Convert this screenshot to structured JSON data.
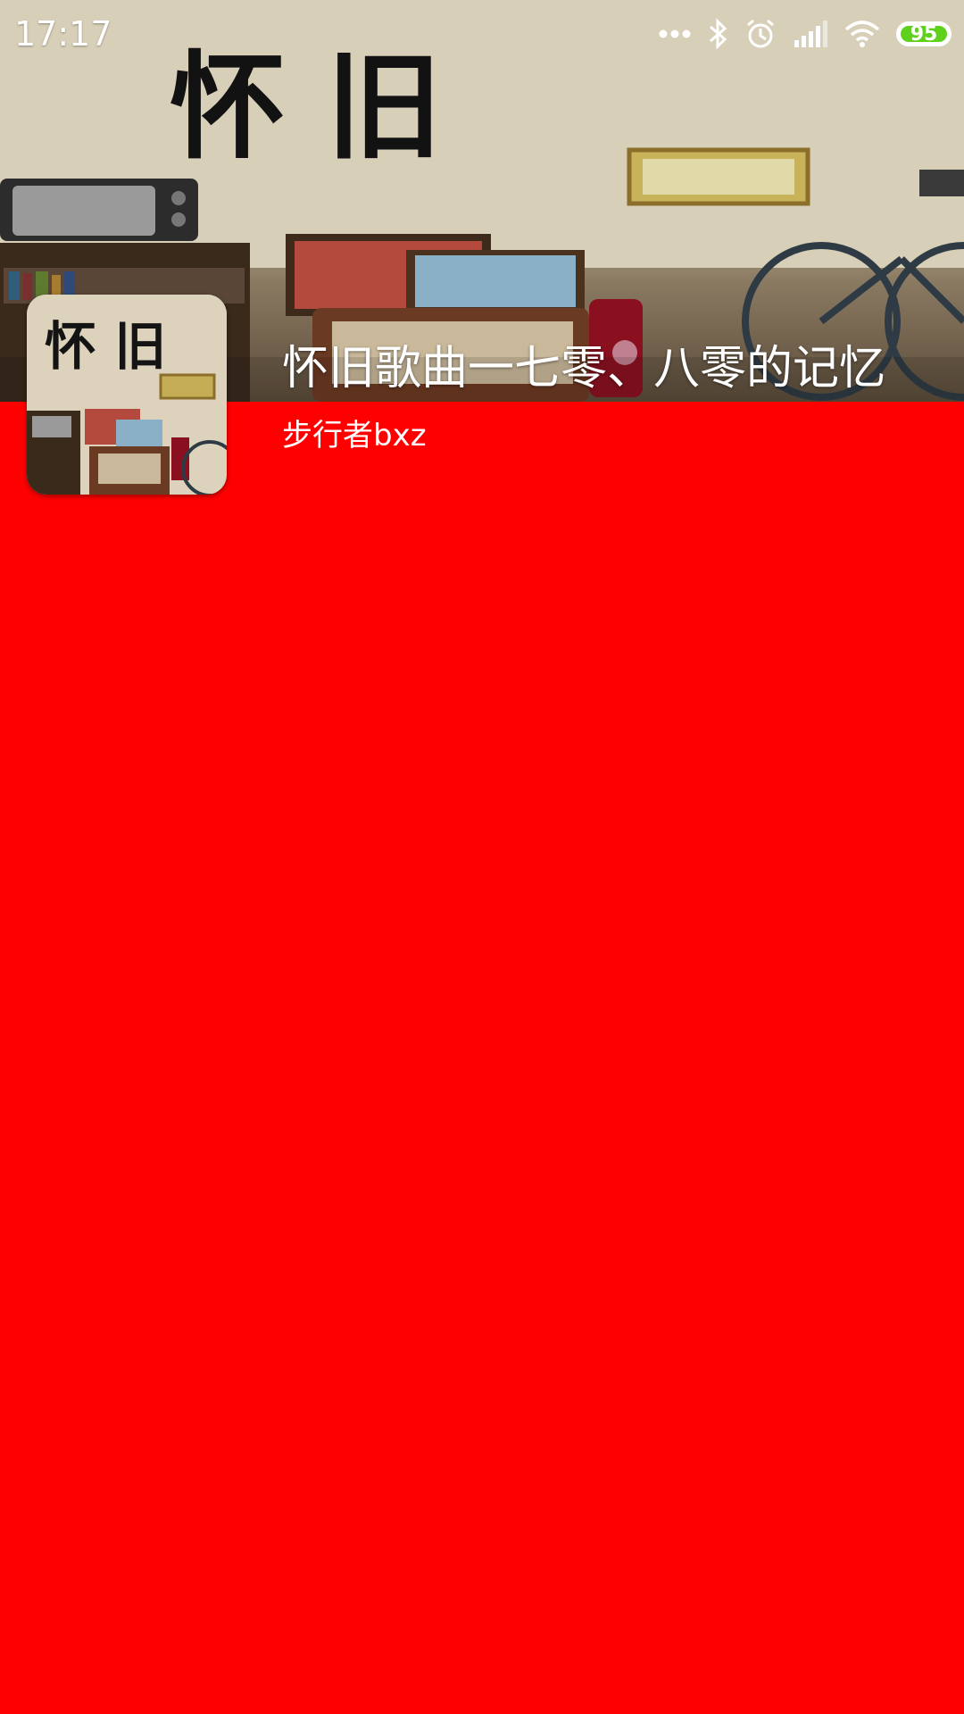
{
  "status_bar": {
    "time": "17:17",
    "battery_level": "95",
    "icons": [
      "more-dots-icon",
      "bluetooth-icon",
      "alarm-icon",
      "signal-icon",
      "wifi-icon",
      "battery-icon"
    ]
  },
  "banner": {
    "image_text": "怀 旧"
  },
  "album": {
    "cover_text": "怀 旧",
    "title": "怀旧歌曲一七零、八零的记忆",
    "author": "步行者bxz"
  },
  "colors": {
    "page_background": "#ff0000",
    "text": "#ffffff",
    "battery_fill": "#5fd01c"
  }
}
